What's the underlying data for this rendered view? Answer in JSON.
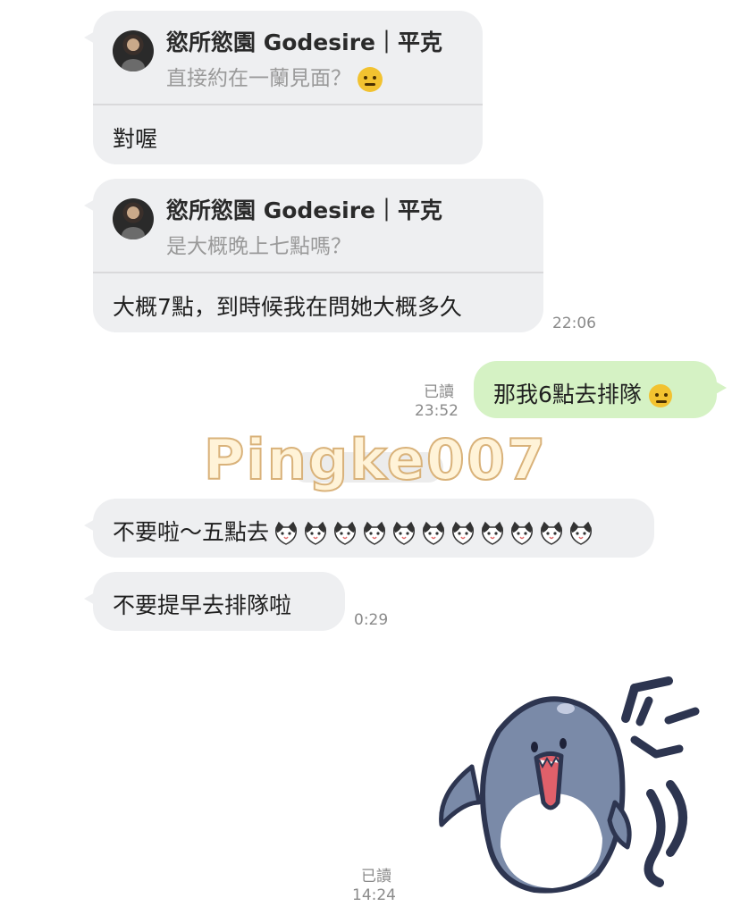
{
  "messages": {
    "m1": {
      "quote_name": "慾所慾園 Godesire｜平克",
      "quote_text": "直接約在一蘭見面？",
      "quote_emoji": "neutral-face-emoji",
      "text": "對喔"
    },
    "m2": {
      "quote_name": "慾所慾園 Godesire｜平克",
      "quote_text": "是大概晚上七點嗎？",
      "text": "大概7點，到時候我在問她大概多久",
      "time": "22:06"
    },
    "m3": {
      "text": "那我6點去排隊",
      "emoji": "rolling-laughing-emoji",
      "read": "已讀",
      "time": "23:52"
    },
    "m4": {
      "text": "不要啦～五點去",
      "emoji_count": 11,
      "emoji": "cat-face-emoji"
    },
    "m5": {
      "text": "不要提早去排隊啦",
      "time": "0:29"
    },
    "m6": {
      "sticker": "shark-sticker",
      "read": "已讀",
      "time": "14:24"
    }
  },
  "watermark": "Pingke007",
  "colors": {
    "incoming_bubble": "#eeeff1",
    "outgoing_bubble": "#d5f2c4",
    "meta_text": "#8a8a8a",
    "quote_text": "#9a9a9a"
  }
}
